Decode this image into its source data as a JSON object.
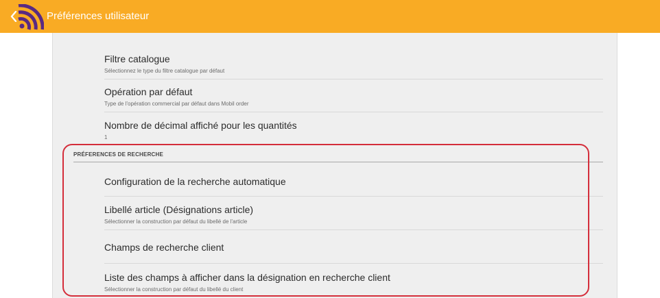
{
  "colors": {
    "action_bar": "#f9ab24",
    "logo_purple": "#5a2a82",
    "highlight_red": "#d42d3a",
    "panel_background": "#efefef"
  },
  "header": {
    "back_icon": "chevron-left-icon",
    "logo_icon": "signal-logo-icon",
    "title": "Préférences utilisateur"
  },
  "preferences": {
    "items": [
      {
        "title": "Filtre catalogue",
        "summary": "Sélectionnez le type du filtre catalogue par défaut"
      },
      {
        "title": "Opération par défaut",
        "summary": "Type de l'opération commercial par défaut dans Mobil order"
      },
      {
        "title": "Nombre de décimal affiché pour les quantités",
        "summary": "1"
      }
    ]
  },
  "search_section": {
    "header": "PRÉFERENCES DE RECHERCHE",
    "items": [
      {
        "title": "Configuration de la recherche automatique"
      },
      {
        "title": "Libellé article (Désignations article)",
        "summary": "Sélectionner la construction par défaut du libellé de l'article"
      },
      {
        "title": "Champs de recherche client"
      },
      {
        "title": "Liste des champs à afficher dans la désignation en recherche client",
        "summary": "Sélectionner la construction par défaut du libellé du client"
      }
    ]
  }
}
